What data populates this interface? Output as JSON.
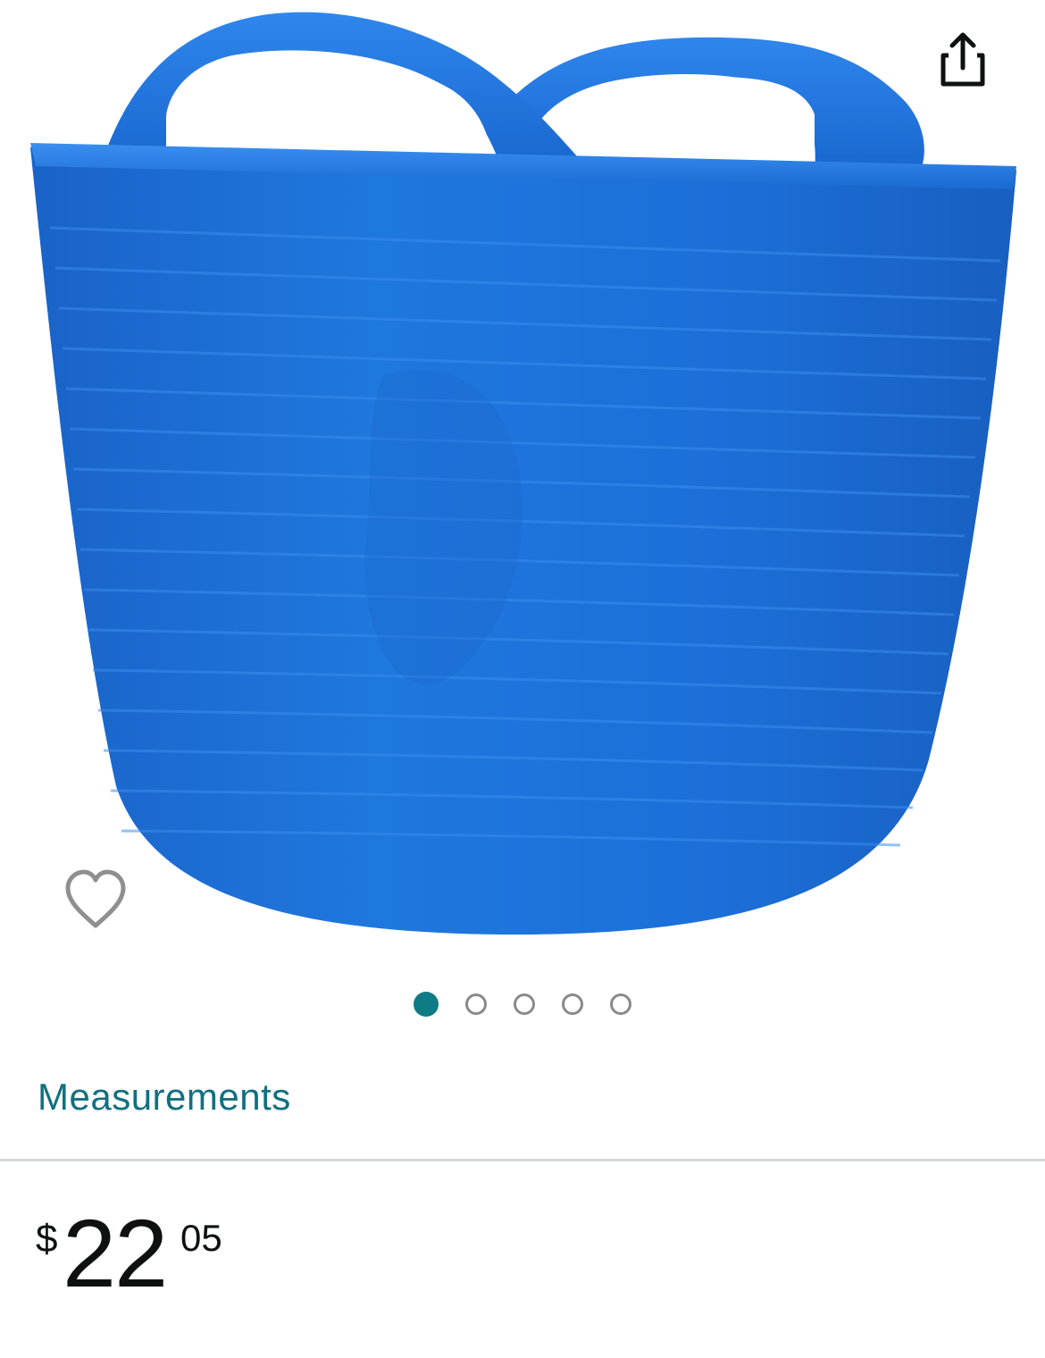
{
  "product": {
    "image_icon": "blue-flexible-tub-image",
    "image_count": 5,
    "active_image_index": 0
  },
  "actions": {
    "share_icon": "share-icon",
    "wishlist_icon": "heart-icon"
  },
  "links": {
    "measurements": "Measurements"
  },
  "price": {
    "currency_symbol": "$",
    "whole": "22",
    "fraction": "05"
  },
  "colors": {
    "accent_teal": "#0f7b85",
    "link_teal": "#11707f",
    "product_blue": "#1d72d8",
    "divider": "#d5d9d9"
  }
}
